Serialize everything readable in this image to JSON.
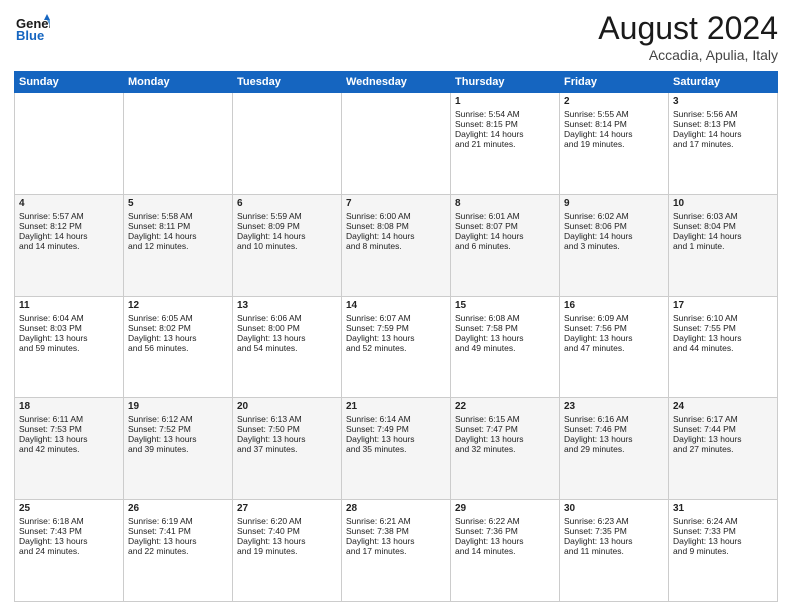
{
  "logo": {
    "line1a": "General",
    "line1b": "Blue",
    "line2": "Blue"
  },
  "title": "August 2024",
  "subtitle": "Accadia, Apulia, Italy",
  "days_of_week": [
    "Sunday",
    "Monday",
    "Tuesday",
    "Wednesday",
    "Thursday",
    "Friday",
    "Saturday"
  ],
  "weeks": [
    [
      {
        "day": "",
        "content": ""
      },
      {
        "day": "",
        "content": ""
      },
      {
        "day": "",
        "content": ""
      },
      {
        "day": "",
        "content": ""
      },
      {
        "day": "1",
        "content": "Sunrise: 5:54 AM\nSunset: 8:15 PM\nDaylight: 14 hours\nand 21 minutes."
      },
      {
        "day": "2",
        "content": "Sunrise: 5:55 AM\nSunset: 8:14 PM\nDaylight: 14 hours\nand 19 minutes."
      },
      {
        "day": "3",
        "content": "Sunrise: 5:56 AM\nSunset: 8:13 PM\nDaylight: 14 hours\nand 17 minutes."
      }
    ],
    [
      {
        "day": "4",
        "content": "Sunrise: 5:57 AM\nSunset: 8:12 PM\nDaylight: 14 hours\nand 14 minutes."
      },
      {
        "day": "5",
        "content": "Sunrise: 5:58 AM\nSunset: 8:11 PM\nDaylight: 14 hours\nand 12 minutes."
      },
      {
        "day": "6",
        "content": "Sunrise: 5:59 AM\nSunset: 8:09 PM\nDaylight: 14 hours\nand 10 minutes."
      },
      {
        "day": "7",
        "content": "Sunrise: 6:00 AM\nSunset: 8:08 PM\nDaylight: 14 hours\nand 8 minutes."
      },
      {
        "day": "8",
        "content": "Sunrise: 6:01 AM\nSunset: 8:07 PM\nDaylight: 14 hours\nand 6 minutes."
      },
      {
        "day": "9",
        "content": "Sunrise: 6:02 AM\nSunset: 8:06 PM\nDaylight: 14 hours\nand 3 minutes."
      },
      {
        "day": "10",
        "content": "Sunrise: 6:03 AM\nSunset: 8:04 PM\nDaylight: 14 hours\nand 1 minute."
      }
    ],
    [
      {
        "day": "11",
        "content": "Sunrise: 6:04 AM\nSunset: 8:03 PM\nDaylight: 13 hours\nand 59 minutes."
      },
      {
        "day": "12",
        "content": "Sunrise: 6:05 AM\nSunset: 8:02 PM\nDaylight: 13 hours\nand 56 minutes."
      },
      {
        "day": "13",
        "content": "Sunrise: 6:06 AM\nSunset: 8:00 PM\nDaylight: 13 hours\nand 54 minutes."
      },
      {
        "day": "14",
        "content": "Sunrise: 6:07 AM\nSunset: 7:59 PM\nDaylight: 13 hours\nand 52 minutes."
      },
      {
        "day": "15",
        "content": "Sunrise: 6:08 AM\nSunset: 7:58 PM\nDaylight: 13 hours\nand 49 minutes."
      },
      {
        "day": "16",
        "content": "Sunrise: 6:09 AM\nSunset: 7:56 PM\nDaylight: 13 hours\nand 47 minutes."
      },
      {
        "day": "17",
        "content": "Sunrise: 6:10 AM\nSunset: 7:55 PM\nDaylight: 13 hours\nand 44 minutes."
      }
    ],
    [
      {
        "day": "18",
        "content": "Sunrise: 6:11 AM\nSunset: 7:53 PM\nDaylight: 13 hours\nand 42 minutes."
      },
      {
        "day": "19",
        "content": "Sunrise: 6:12 AM\nSunset: 7:52 PM\nDaylight: 13 hours\nand 39 minutes."
      },
      {
        "day": "20",
        "content": "Sunrise: 6:13 AM\nSunset: 7:50 PM\nDaylight: 13 hours\nand 37 minutes."
      },
      {
        "day": "21",
        "content": "Sunrise: 6:14 AM\nSunset: 7:49 PM\nDaylight: 13 hours\nand 35 minutes."
      },
      {
        "day": "22",
        "content": "Sunrise: 6:15 AM\nSunset: 7:47 PM\nDaylight: 13 hours\nand 32 minutes."
      },
      {
        "day": "23",
        "content": "Sunrise: 6:16 AM\nSunset: 7:46 PM\nDaylight: 13 hours\nand 29 minutes."
      },
      {
        "day": "24",
        "content": "Sunrise: 6:17 AM\nSunset: 7:44 PM\nDaylight: 13 hours\nand 27 minutes."
      }
    ],
    [
      {
        "day": "25",
        "content": "Sunrise: 6:18 AM\nSunset: 7:43 PM\nDaylight: 13 hours\nand 24 minutes."
      },
      {
        "day": "26",
        "content": "Sunrise: 6:19 AM\nSunset: 7:41 PM\nDaylight: 13 hours\nand 22 minutes."
      },
      {
        "day": "27",
        "content": "Sunrise: 6:20 AM\nSunset: 7:40 PM\nDaylight: 13 hours\nand 19 minutes."
      },
      {
        "day": "28",
        "content": "Sunrise: 6:21 AM\nSunset: 7:38 PM\nDaylight: 13 hours\nand 17 minutes."
      },
      {
        "day": "29",
        "content": "Sunrise: 6:22 AM\nSunset: 7:36 PM\nDaylight: 13 hours\nand 14 minutes."
      },
      {
        "day": "30",
        "content": "Sunrise: 6:23 AM\nSunset: 7:35 PM\nDaylight: 13 hours\nand 11 minutes."
      },
      {
        "day": "31",
        "content": "Sunrise: 6:24 AM\nSunset: 7:33 PM\nDaylight: 13 hours\nand 9 minutes."
      }
    ]
  ]
}
